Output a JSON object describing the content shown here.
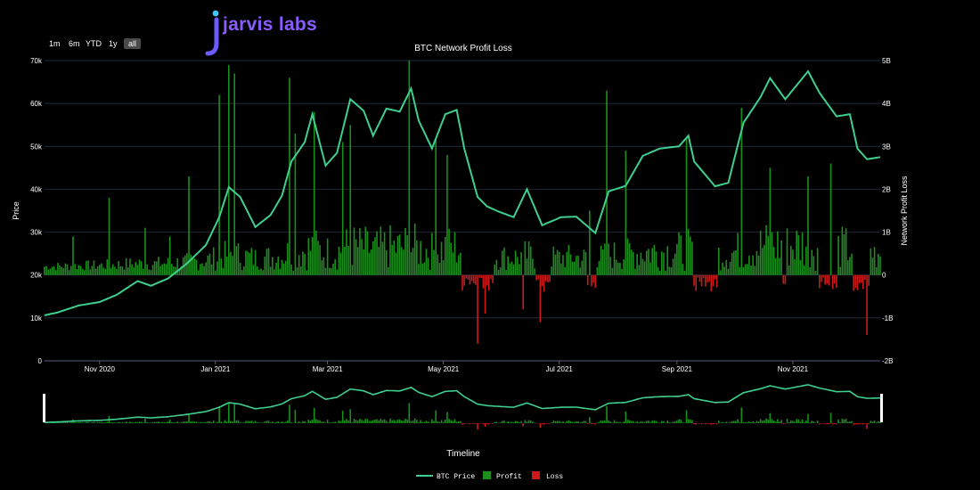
{
  "brand": {
    "logo_text": "jarvis labs",
    "logo_icon": "jarvis-j-icon",
    "logo_color": "#8a5cff"
  },
  "range_selector": {
    "buttons": [
      "1m",
      "6m",
      "YTD",
      "1y",
      "all"
    ],
    "active": "all"
  },
  "navigator": {
    "label": "Timeline"
  },
  "chart_data": {
    "type": "bar+line",
    "title": "BTC Network Profit Loss",
    "xaxis": {
      "start": "2020-10-03",
      "end": "2021-12-17",
      "tick_labels": [
        "Nov 2020",
        "Jan 2021",
        "Mar 2021",
        "May 2021",
        "Jul 2021",
        "Sep 2021",
        "Nov 2021"
      ]
    },
    "y_left": {
      "label": "Price",
      "range": [
        0,
        70000
      ],
      "tick_labels": [
        "0",
        "10k",
        "20k",
        "30k",
        "40k",
        "50k",
        "60k",
        "70k"
      ]
    },
    "y_right": {
      "label": "Network Profit Loss",
      "range": [
        -2000000000,
        5000000000
      ],
      "tick_labels": [
        "-2B",
        "-1B",
        "0",
        "1B",
        "2B",
        "3B",
        "4B",
        "5B"
      ]
    },
    "grid": true,
    "legend": {
      "position": "bottom-center",
      "entries": [
        "BTC Price",
        "Profit",
        "Loss"
      ]
    },
    "colors": {
      "price": "#3fcf8e",
      "profit": "#1b8f1b",
      "loss": "#cc1a1a",
      "grid": "#2e3a52"
    },
    "price_series": {
      "name": "BTC Price",
      "points": [
        [
          "2020-10-03",
          10600
        ],
        [
          "2020-10-10",
          11300
        ],
        [
          "2020-10-21",
          12900
        ],
        [
          "2020-11-01",
          13700
        ],
        [
          "2020-11-10",
          15400
        ],
        [
          "2020-11-21",
          18600
        ],
        [
          "2020-11-28",
          17500
        ],
        [
          "2020-12-07",
          19200
        ],
        [
          "2020-12-17",
          22700
        ],
        [
          "2020-12-27",
          27000
        ],
        [
          "2021-01-03",
          33500
        ],
        [
          "2021-01-08",
          40500
        ],
        [
          "2021-01-14",
          38200
        ],
        [
          "2021-01-22",
          31200
        ],
        [
          "2021-01-30",
          34000
        ],
        [
          "2021-02-05",
          38500
        ],
        [
          "2021-02-10",
          46500
        ],
        [
          "2021-02-17",
          51000
        ],
        [
          "2021-02-21",
          57500
        ],
        [
          "2021-02-28",
          45500
        ],
        [
          "2021-03-06",
          48500
        ],
        [
          "2021-03-13",
          61000
        ],
        [
          "2021-03-20",
          58300
        ],
        [
          "2021-03-25",
          52500
        ],
        [
          "2021-04-01",
          58800
        ],
        [
          "2021-04-08",
          58100
        ],
        [
          "2021-04-14",
          63500
        ],
        [
          "2021-04-18",
          56000
        ],
        [
          "2021-04-25",
          49500
        ],
        [
          "2021-05-02",
          57500
        ],
        [
          "2021-05-08",
          58500
        ],
        [
          "2021-05-12",
          49500
        ],
        [
          "2021-05-19",
          38200
        ],
        [
          "2021-05-24",
          36000
        ],
        [
          "2021-05-30",
          34800
        ],
        [
          "2021-06-07",
          33500
        ],
        [
          "2021-06-14",
          40000
        ],
        [
          "2021-06-22",
          31600
        ],
        [
          "2021-07-02",
          33500
        ],
        [
          "2021-07-10",
          33600
        ],
        [
          "2021-07-20",
          29800
        ],
        [
          "2021-07-27",
          39500
        ],
        [
          "2021-08-05",
          40800
        ],
        [
          "2021-08-14",
          47800
        ],
        [
          "2021-08-23",
          49500
        ],
        [
          "2021-09-02",
          50000
        ],
        [
          "2021-09-07",
          52500
        ],
        [
          "2021-09-10",
          46500
        ],
        [
          "2021-09-21",
          40700
        ],
        [
          "2021-09-28",
          41500
        ],
        [
          "2021-10-06",
          55500
        ],
        [
          "2021-10-15",
          61500
        ],
        [
          "2021-10-20",
          65900
        ],
        [
          "2021-10-28",
          61000
        ],
        [
          "2021-11-09",
          67500
        ],
        [
          "2021-11-15",
          62500
        ],
        [
          "2021-11-24",
          57000
        ],
        [
          "2021-12-01",
          57500
        ],
        [
          "2021-12-05",
          49500
        ],
        [
          "2021-12-10",
          47000
        ],
        [
          "2021-12-17",
          47500
        ]
      ]
    },
    "profit_peaks": [
      [
        "2020-10-18",
        0.9
      ],
      [
        "2020-11-06",
        1.8
      ],
      [
        "2020-11-25",
        1.1
      ],
      [
        "2020-12-08",
        0.9
      ],
      [
        "2020-12-18",
        2.3
      ],
      [
        "2021-01-03",
        4.2
      ],
      [
        "2021-01-08",
        4.9
      ],
      [
        "2021-01-11",
        4.7
      ],
      [
        "2021-02-09",
        4.6
      ],
      [
        "2021-02-12",
        3.3
      ],
      [
        "2021-02-22",
        3.8
      ],
      [
        "2021-03-09",
        3.1
      ],
      [
        "2021-03-13",
        3.5
      ],
      [
        "2021-04-13",
        5.0
      ],
      [
        "2021-04-27",
        3.2
      ],
      [
        "2021-05-03",
        2.8
      ],
      [
        "2021-07-17",
        1.5
      ],
      [
        "2021-07-26",
        4.3
      ],
      [
        "2021-08-05",
        2.9
      ],
      [
        "2021-09-06",
        3.2
      ],
      [
        "2021-10-05",
        3.9
      ],
      [
        "2021-10-20",
        2.5
      ],
      [
        "2021-11-09",
        2.3
      ],
      [
        "2021-11-21",
        2.6
      ],
      [
        "2021-12-04",
        3.2
      ]
    ],
    "loss_peaks": [
      [
        "2021-05-19",
        -1.6
      ],
      [
        "2021-05-23",
        -0.9
      ],
      [
        "2021-06-12",
        -0.8
      ],
      [
        "2021-06-21",
        -1.1
      ],
      [
        "2021-07-20",
        -0.3
      ],
      [
        "2021-12-04",
        -0.3
      ],
      [
        "2021-12-10",
        -1.4
      ]
    ],
    "series": [
      {
        "name": "BTC Price",
        "axis": "left"
      },
      {
        "name": "Profit",
        "axis": "right"
      },
      {
        "name": "Loss",
        "axis": "right"
      }
    ]
  }
}
